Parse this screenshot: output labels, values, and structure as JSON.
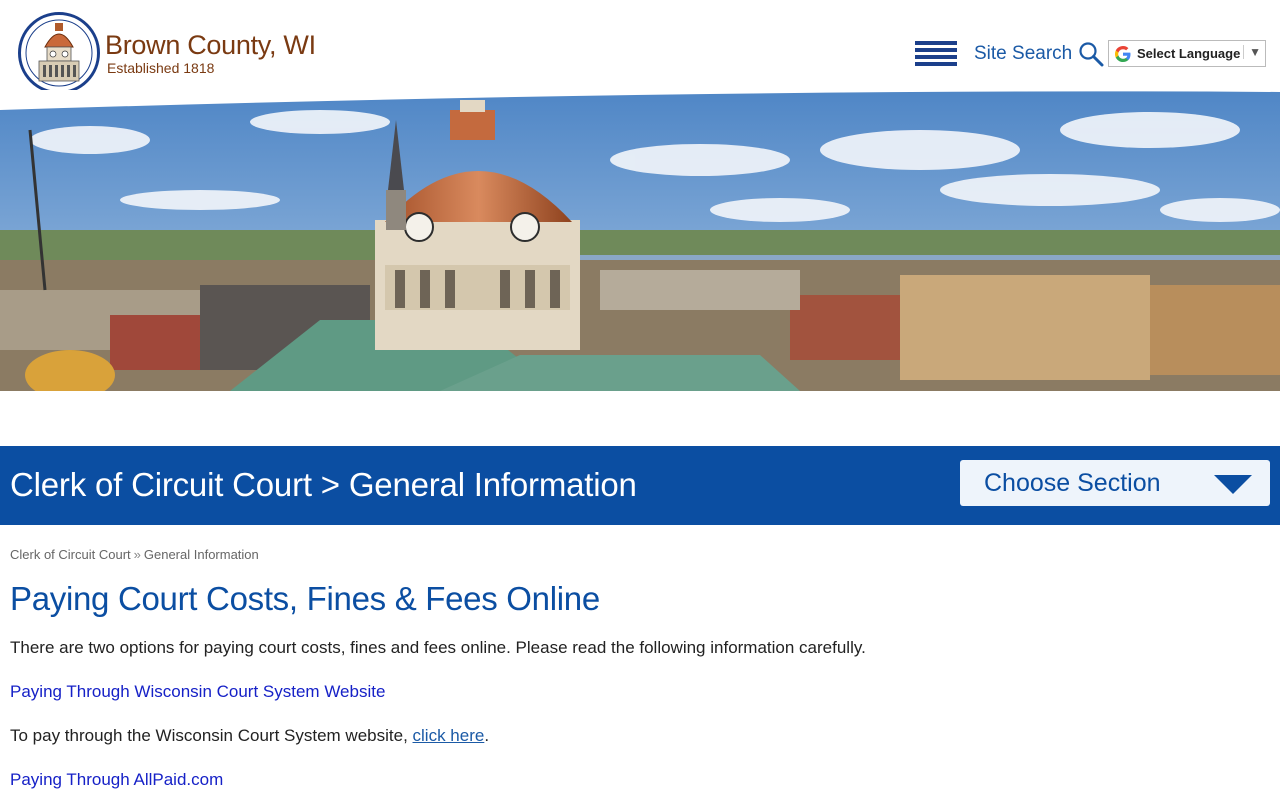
{
  "header": {
    "site_title": "Brown County, WI",
    "site_subtitle": "Established 1818",
    "site_search_label": "Site Search",
    "language_select_label": "Select Language",
    "language_arrow": "▼"
  },
  "title_band": {
    "heading": "Clerk of Circuit Court > General Information",
    "choose_section_label": "Choose Section"
  },
  "breadcrumb": {
    "items": [
      "Clerk of Circuit Court",
      "General Information"
    ],
    "separator": "»"
  },
  "content": {
    "title": "Paying Court Costs, Fines & Fees Online",
    "intro": "There are two options for paying court costs, fines and fees online. Please read the following information carefully.",
    "option1_heading": "Paying Through Wisconsin Court System Website",
    "option1_text_before": "To pay through the Wisconsin Court System website, ",
    "option1_link": "click here",
    "option1_text_after": ".",
    "option2_heading": "Paying Through AllPaid.com"
  },
  "colors": {
    "brand_blue": "#0b4ea2",
    "logo_brown": "#7a3a12",
    "link_blue": "#1621c7"
  },
  "icons": {
    "menu": "hamburger-menu-icon",
    "search": "search-icon",
    "google": "google-g-icon",
    "chevron": "chevron-down-icon",
    "seal": "courthouse-seal-logo"
  }
}
